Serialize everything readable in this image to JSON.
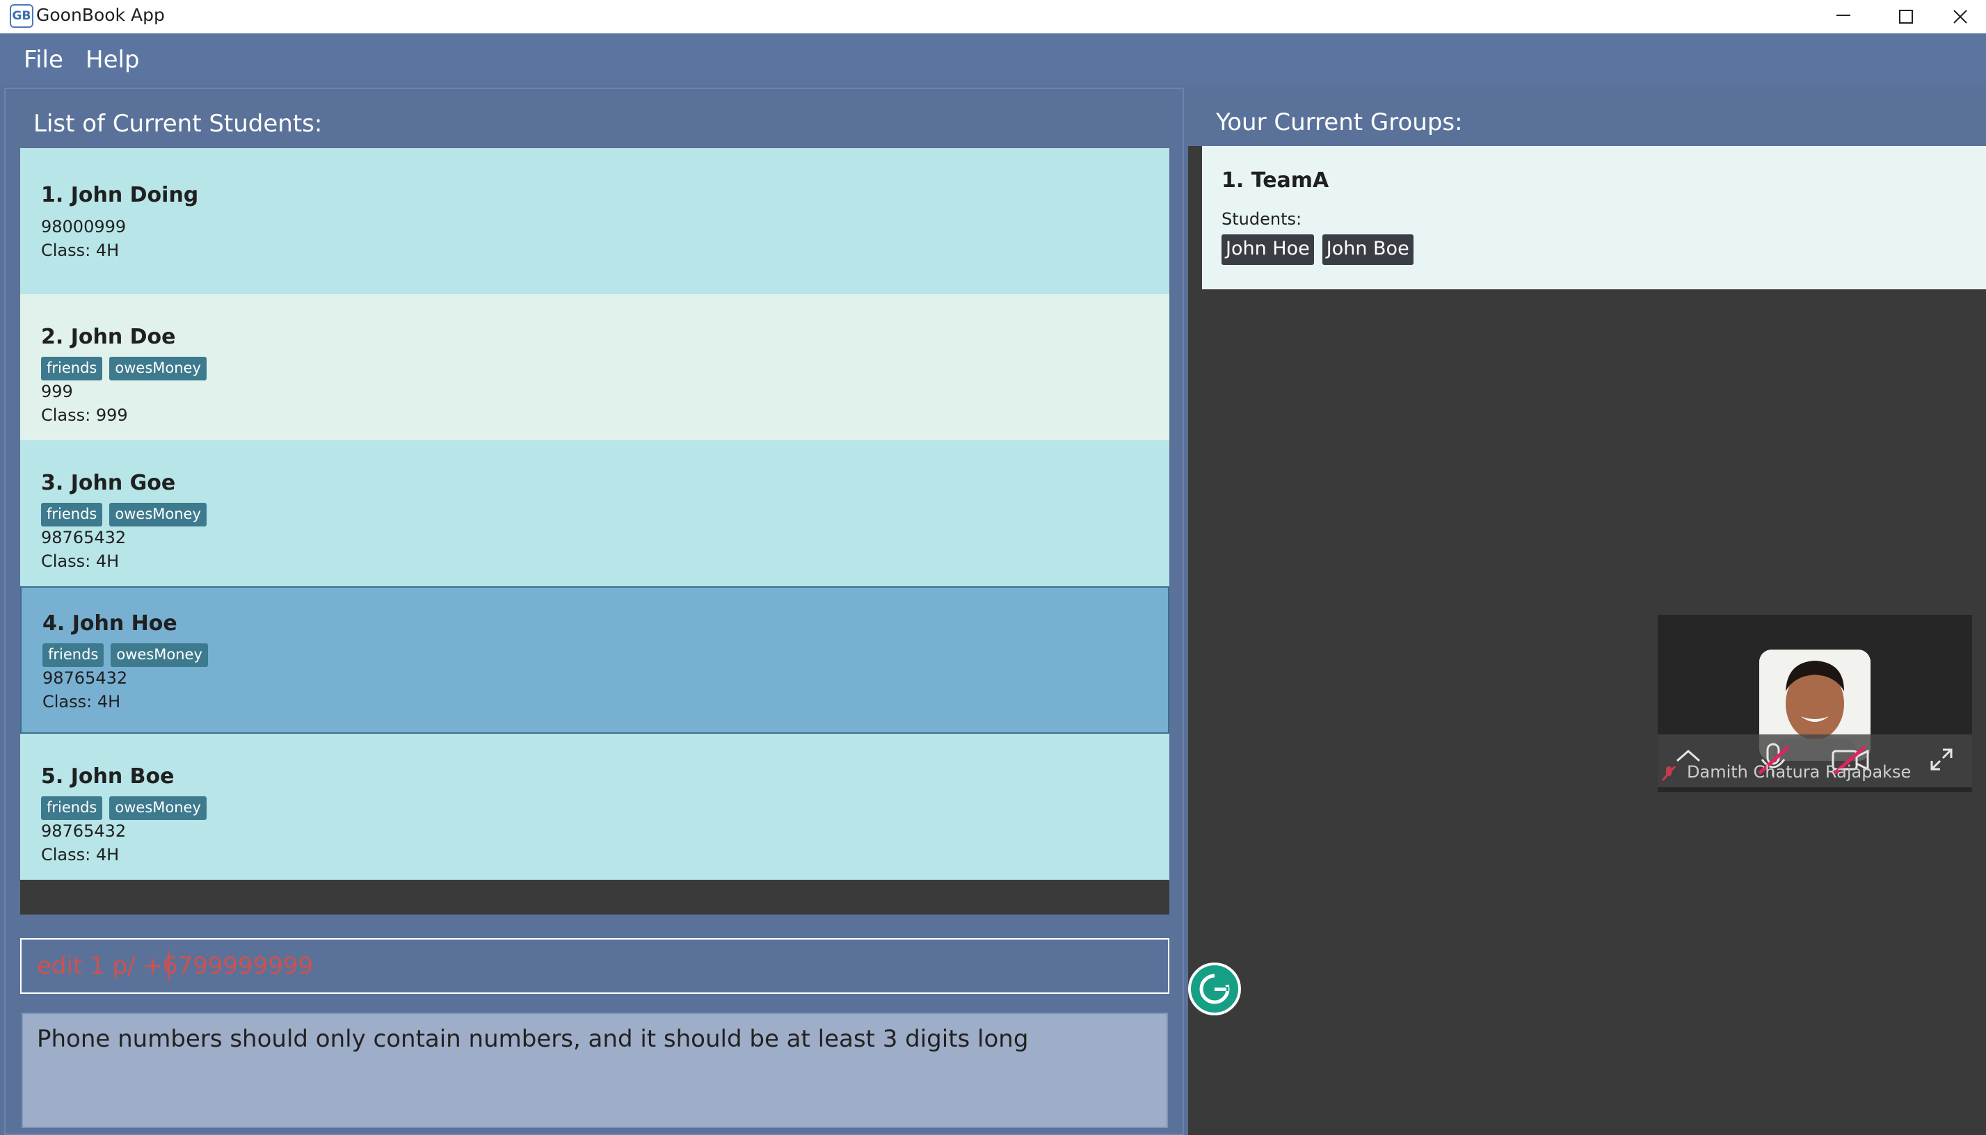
{
  "window": {
    "title": "GoonBook App",
    "icon_letters": "GB"
  },
  "menu": {
    "file": "File",
    "help": "Help"
  },
  "students_panel": {
    "heading": "List of Current Students:",
    "students": [
      {
        "name": "1. John Doing",
        "tags": [],
        "phone": "98000999",
        "class": "Class: 4H"
      },
      {
        "name": "2. John Doe",
        "tags": [
          "friends",
          "owesMoney"
        ],
        "phone": "999",
        "class": "Class: 999"
      },
      {
        "name": "3. John Goe",
        "tags": [
          "friends",
          "owesMoney"
        ],
        "phone": "98765432",
        "class": "Class: 4H"
      },
      {
        "name": "4. John Hoe",
        "tags": [
          "friends",
          "owesMoney"
        ],
        "phone": "98765432",
        "class": "Class: 4H"
      },
      {
        "name": "5. John Boe",
        "tags": [
          "friends",
          "owesMoney"
        ],
        "phone": "98765432",
        "class": "Class: 4H"
      }
    ],
    "selected_index": 3
  },
  "command_box": {
    "value": "edit 1 p/ +6799999999"
  },
  "result_box": {
    "text": "Phone numbers should only contain numbers, and it should be at least 3 digits long"
  },
  "groups_panel": {
    "heading": "Your Current Groups:",
    "groups": [
      {
        "name": "1. TeamA",
        "students_label": "Students:",
        "members": [
          "John Hoe",
          "John Boe"
        ]
      }
    ]
  },
  "video_call": {
    "participant": "Damith Chatura Rajapakse",
    "icons": [
      "chevron-up-icon",
      "mic-muted-icon",
      "camera-off-icon",
      "expand-icon"
    ]
  },
  "colors": {
    "background": "#5a7299",
    "card_a": "#b7e5e8",
    "card_b": "#e1f2ec",
    "card_selected": "#78b0d2",
    "tag": "#3d7a8e",
    "error_text": "#d0504f"
  }
}
